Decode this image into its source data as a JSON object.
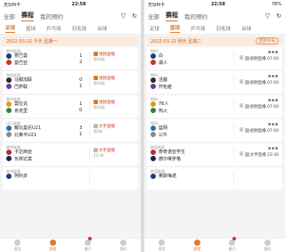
{
  "left": {
    "status": {
      "carrier": "无SIM卡",
      "time": "22:58"
    },
    "nav": {
      "tabs": [
        "全部",
        "赛程",
        "我的预约"
      ],
      "active": "赛程"
    },
    "subtabs": {
      "items": [
        "足球",
        "篮球",
        "乒乓球",
        "羽毛球",
        "台球"
      ],
      "active": "足球"
    },
    "date_banner": {
      "text": "2022-03-21 今天 星期一"
    },
    "matches": [
      {
        "league": "意甲联赛",
        "home": "意巴曼",
        "away": "曼巴亚",
        "home_score": "1",
        "away_score": "2",
        "right1": "视频直播",
        "right2": "第30轮"
      },
      {
        "league": "挪超联赛",
        "home": "马都加联",
        "away": "巴萨联",
        "home_score": "0",
        "away_score": "1",
        "right1": "视频直播",
        "right2": "第30轮"
      },
      {
        "league": "意甲联赛",
        "home": "莫拉关",
        "away": "肯克里",
        "home_score": "1",
        "away_score": "0",
        "right1": "视频直播",
        "right2": "第30轮"
      },
      {
        "league": "U21联赛",
        "home": "戴北曼尼U21",
        "away": "北莱平U21",
        "home_score": "3",
        "away_score": "1",
        "right1": "文字直播",
        "right2": "第2轮"
      },
      {
        "league": "意甲联赛",
        "home": "卡达西亚",
        "away": "瓦林达莫",
        "home_score": "",
        "away_score": "",
        "right1": "文字直播",
        "right2": "23:30"
      },
      {
        "league": "意甲联赛",
        "home": "阿利多",
        "away": "",
        "home_score": "",
        "away_score": "",
        "right1": "",
        "right2": ""
      }
    ],
    "bottom": [
      "首页",
      "赛程",
      "圈子",
      "我的"
    ]
  },
  "right": {
    "status": {
      "carrier": "无SIM卡",
      "time": "22:58",
      "battery": "78%"
    },
    "nav": {
      "tabs": [
        "全部",
        "赛程",
        "我的预约"
      ],
      "active": "赛程"
    },
    "subtabs": {
      "items": [
        "足球",
        "篮球",
        "乒乓球",
        "羽毛球",
        "台球"
      ],
      "active": "篮球"
    },
    "date_banner": {
      "text": "2022-03-22 明天 星期二",
      "pill": "回到今日"
    },
    "matches": [
      {
        "league": "NBA",
        "home": "白",
        "away": "湖人",
        "time": "07:00",
        "right1": "视频直播"
      },
      {
        "league": "NBA",
        "home": "活塞",
        "away": "开拓者",
        "time": "07:00",
        "right1": "视频直播"
      },
      {
        "league": "NBA",
        "home": "76人",
        "away": "热火",
        "time": "07:00",
        "right1": "视频直播"
      },
      {
        "league": "NBA",
        "home": "篮网",
        "away": "公牛",
        "time": "07:00",
        "right1": "视频直播"
      },
      {
        "league": "欧篮联赛",
        "home": "奇奇诺亚学生",
        "away": "德尔维罗格",
        "time": "22:30",
        "right1": "文字直播"
      },
      {
        "league": "欧篮联赛",
        "home": "奥斯梅诺",
        "away": "",
        "time": "",
        "right1": ""
      }
    ],
    "bottom": [
      "首页",
      "赛程",
      "圈子",
      "我的"
    ]
  }
}
